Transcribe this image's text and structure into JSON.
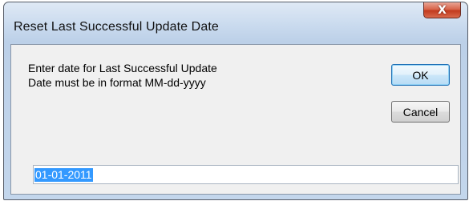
{
  "window": {
    "title": "Reset Last Successful Update Date",
    "close_glyph": "X"
  },
  "dialog": {
    "prompt_line_1": "Enter date for Last Successful Update",
    "prompt_line_2": "Date must be in format MM-dd-yyyy",
    "ok_label": "OK",
    "cancel_label": "Cancel",
    "date_value": "01-01-2011",
    "date_selected": true
  },
  "colors": {
    "close_button": "#c23a1e",
    "selection_highlight": "#3399ff",
    "title_bar": "#c3d6ec",
    "client_background": "#f0f0f0"
  }
}
